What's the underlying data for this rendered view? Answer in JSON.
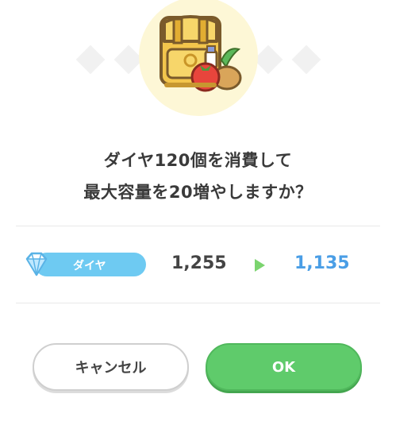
{
  "dialog": {
    "message_line1": "ダイヤ120個を消費して",
    "message_line2": "最大容量を20増やしますか？",
    "illustration_icon": "backpack-with-food-icon",
    "currency": {
      "label": "ダイヤ",
      "icon": "diamond-gem-icon",
      "current": "1,255",
      "after": "1,135",
      "arrow_icon": "right-arrow-icon"
    },
    "buttons": {
      "cancel_label": "キャンセル",
      "ok_label": "OK"
    },
    "colors": {
      "ok_green": "#5fcb6b",
      "currency_blue": "#6ecaf2",
      "after_value_blue": "#4a9ee6",
      "icon_background": "#fdf7d6"
    }
  }
}
